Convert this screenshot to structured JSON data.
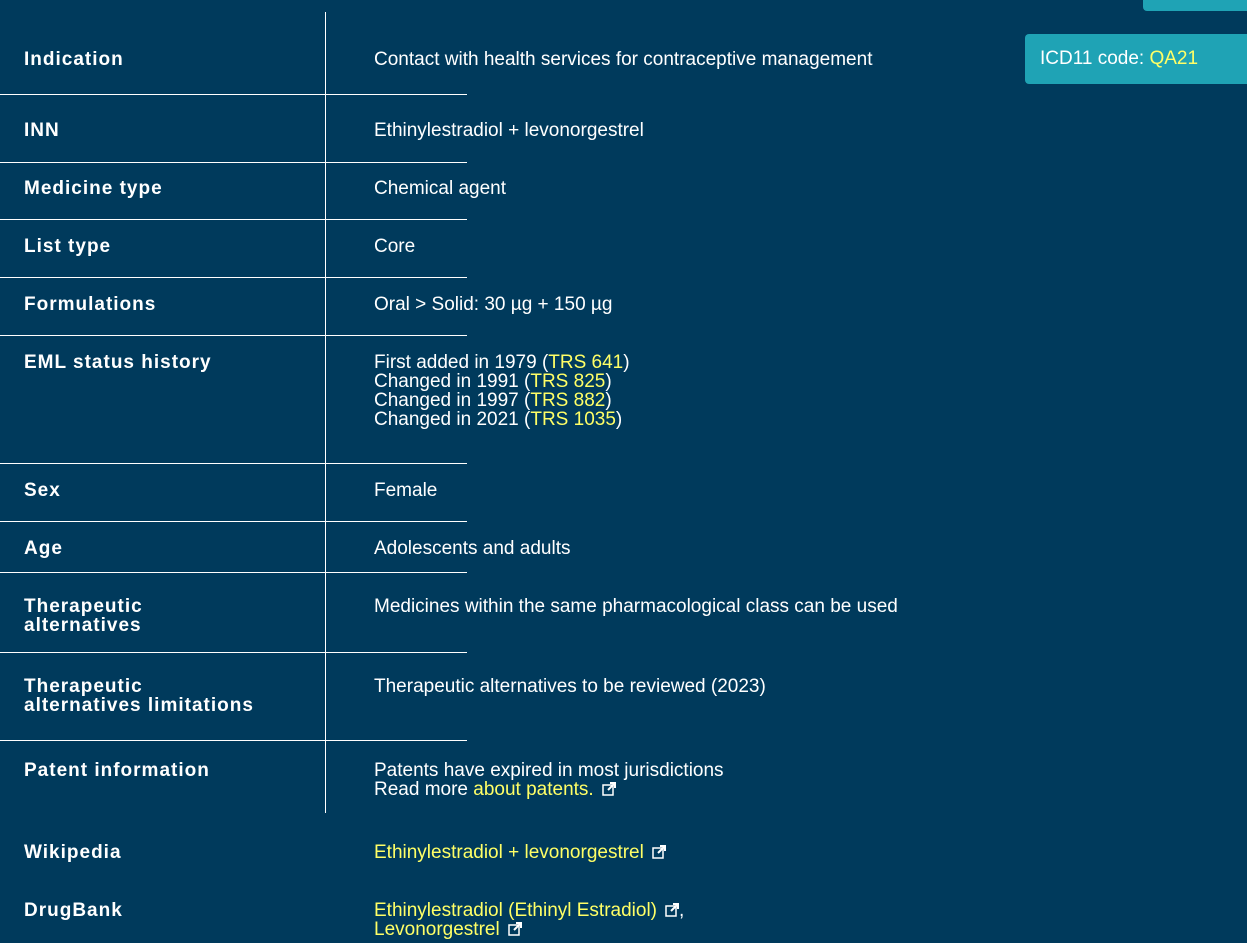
{
  "rows": {
    "indication": {
      "label": "Indication",
      "value": "Contact with health services for contraceptive management",
      "icd_prefix": "ICD11 code: ",
      "icd_code": "QA21"
    },
    "inn": {
      "label": "INN",
      "value": "Ethinylestradiol + levonorgestrel"
    },
    "medicine_type": {
      "label": "Medicine type",
      "value": "Chemical agent"
    },
    "list_type": {
      "label": "List type",
      "value": "Core"
    },
    "formulations": {
      "label": "Formulations",
      "value": "Oral > Solid: 30 µg + 150 µg"
    },
    "eml_status": {
      "label": "EML status history",
      "entries": [
        {
          "text": "First added in 1979 (",
          "link": "TRS 641",
          "close": ")"
        },
        {
          "text": "Changed in 1991 (",
          "link": "TRS 825",
          "close": ")"
        },
        {
          "text": "Changed in 1997 (",
          "link": "TRS 882",
          "close": ")"
        },
        {
          "text": "Changed in 2021 (",
          "link": "TRS 1035",
          "close": ")"
        }
      ]
    },
    "sex": {
      "label": "Sex",
      "value": "Female"
    },
    "age": {
      "label": "Age",
      "value": "Adolescents and adults"
    },
    "ther_alt": {
      "label_line1": "Therapeutic",
      "label_line2": "alternatives",
      "value": "Medicines within the same pharmacological class can be used"
    },
    "ther_alt_lim": {
      "label_line1": "Therapeutic",
      "label_line2": "alternatives limitations",
      "value": "Therapeutic alternatives to be reviewed (2023)"
    },
    "patent": {
      "label": "Patent information",
      "line1": "Patents have expired in most jurisdictions",
      "line2_prefix": "Read more ",
      "line2_link": "about patents."
    },
    "wikipedia": {
      "label": "Wikipedia",
      "link": "Ethinylestradiol + levonorgestrel"
    },
    "drugbank": {
      "label": "DrugBank",
      "link1": "Ethinylestradiol (Ethinyl Estradiol)",
      "sep": ",",
      "link2": "Levonorgestrel"
    }
  },
  "colors": {
    "background": "#003a5c",
    "link": "#ffff66",
    "badge": "#1fa3b5",
    "text": "#ffffff"
  },
  "icons": {
    "external": "external-link-icon"
  }
}
